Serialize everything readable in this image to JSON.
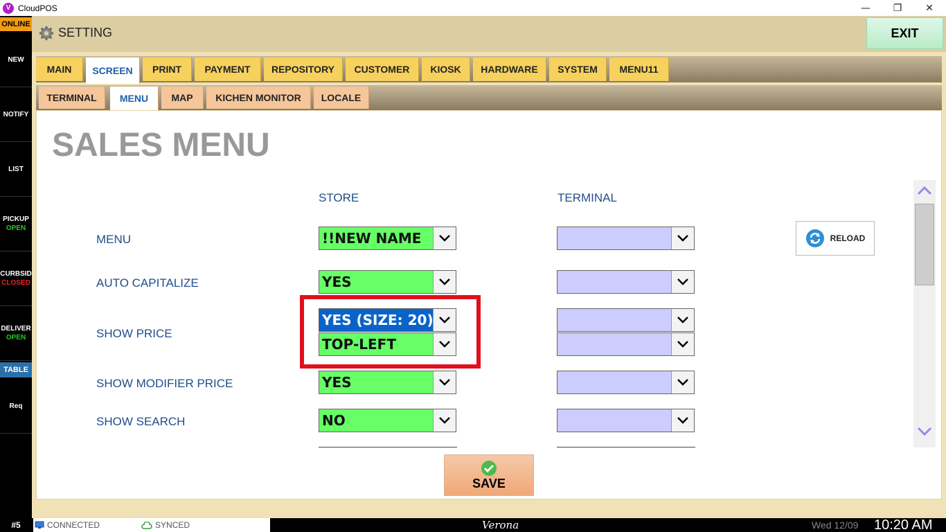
{
  "window": {
    "title": "CloudPOS",
    "logo_letter": "V",
    "minimize": "—",
    "restore": "❐",
    "close": "✕"
  },
  "sidebar": {
    "status": "ONLINE",
    "items": [
      {
        "label": "NEW",
        "sub": ""
      },
      {
        "label": "NOTIFY",
        "sub": ""
      },
      {
        "label": "LIST",
        "sub": ""
      },
      {
        "label": "PICKUP",
        "sub": "OPEN",
        "sub_color": "#22cc22"
      },
      {
        "label": "CURBSID",
        "sub": "CLOSED",
        "sub_color": "#ee2222"
      },
      {
        "label": "DELIVER",
        "sub": "OPEN",
        "sub_color": "#22cc22"
      }
    ],
    "table": "TABLE",
    "req": "Req"
  },
  "header": {
    "title": "SETTING",
    "exit": "EXIT"
  },
  "tabs": {
    "main": [
      {
        "label": "MAIN"
      },
      {
        "label": "SCREEN",
        "active": true
      },
      {
        "label": "PRINT"
      },
      {
        "label": "PAYMENT"
      },
      {
        "label": "REPOSITORY"
      },
      {
        "label": "CUSTOMER"
      },
      {
        "label": "KIOSK"
      },
      {
        "label": "HARDWARE"
      },
      {
        "label": "SYSTEM"
      },
      {
        "label": "MENU11"
      }
    ],
    "sub": [
      {
        "label": "TERMINAL"
      },
      {
        "label": "MENU",
        "active": true
      },
      {
        "label": "MAP"
      },
      {
        "label": "KICHEN MONITOR"
      },
      {
        "label": "LOCALE"
      }
    ]
  },
  "page": {
    "title": "SALES MENU",
    "col_store": "STORE",
    "col_terminal": "TERMINAL",
    "rows": [
      {
        "label": "MENU",
        "store": "!!NEW NAME",
        "terminal": ""
      },
      {
        "label": "AUTO CAPITALIZE",
        "store": "YES",
        "terminal": ""
      },
      {
        "label": "SHOW PRICE",
        "store": "YES (SIZE: 20)",
        "store2": "TOP-LEFT",
        "terminal": "",
        "terminal2": ""
      },
      {
        "label": "SHOW MODIFIER PRICE",
        "store": "YES",
        "terminal": ""
      },
      {
        "label": "SHOW SEARCH",
        "store": "NO",
        "terminal": ""
      }
    ],
    "reload": "RELOAD",
    "save": "SAVE"
  },
  "statusbar": {
    "badge": "#5",
    "connected": "CONNECTED",
    "synced": "SYNCED",
    "store": "Verona",
    "date": "Wed 12/09",
    "time": "10:20 AM"
  },
  "colors": {
    "accent": "#1f5fa8",
    "store_dropdown": "#66ff66",
    "terminal_dropdown": "#ccccff",
    "highlight": "#e0101c"
  }
}
